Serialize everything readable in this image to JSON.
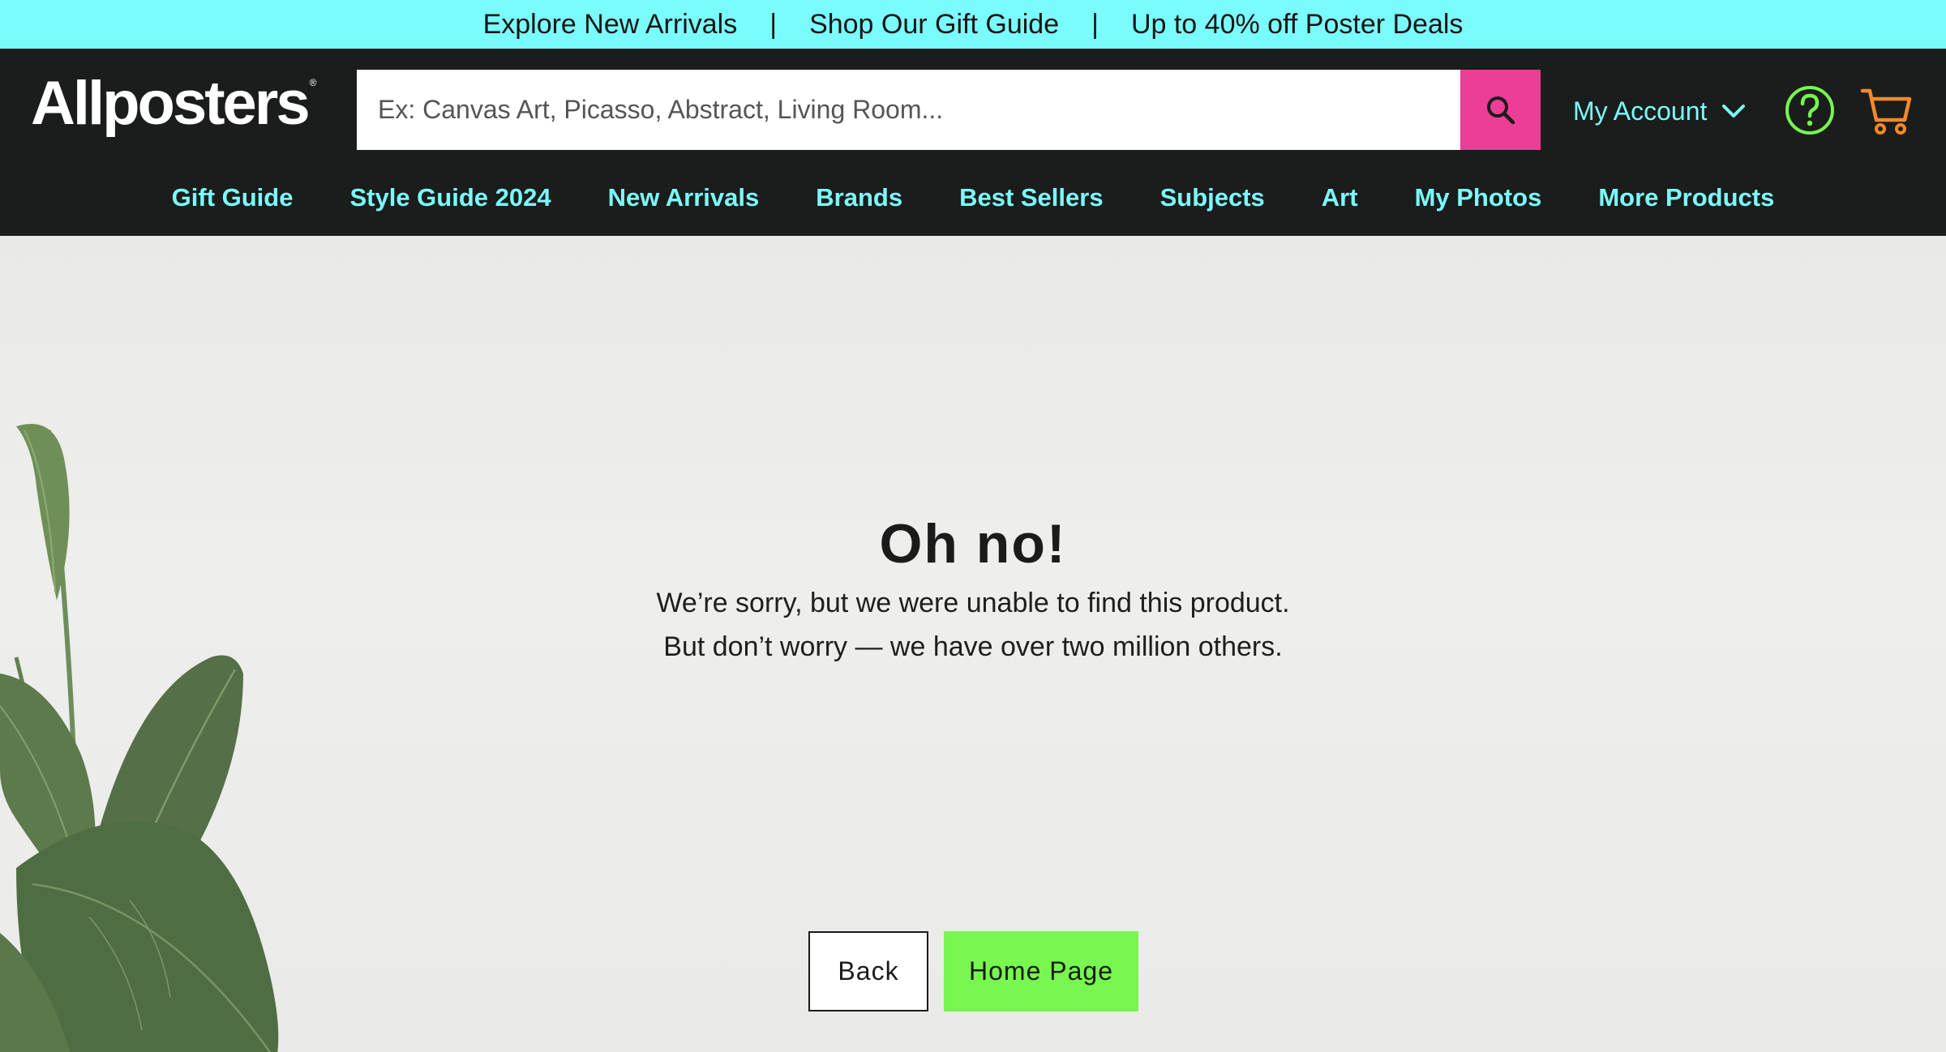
{
  "promo": {
    "items": [
      "Explore New Arrivals",
      "Shop Our Gift Guide",
      "Up to 40% off Poster Deals"
    ],
    "separator": "|"
  },
  "header": {
    "logo": "Allposters",
    "logo_mark": "®",
    "search_placeholder": "Ex: Canvas Art, Picasso, Abstract, Living Room...",
    "account_label": "My Account",
    "icons": {
      "search": "search-icon",
      "account_toggle": "chevron-down-icon",
      "help": "help-icon",
      "cart": "cart-icon"
    },
    "colors": {
      "search_button": "#ec3d97",
      "help_icon": "#77f74f",
      "cart_icon": "#f28a2b",
      "accent": "#7bfcfc"
    }
  },
  "nav": {
    "items": [
      "Gift Guide",
      "Style Guide 2024",
      "New Arrivals",
      "Brands",
      "Best Sellers",
      "Subjects",
      "Art",
      "My Photos",
      "More Products"
    ]
  },
  "error": {
    "title": "Oh no!",
    "line1": "We’re sorry, but we were unable to find this product.",
    "line2": "But don’t worry — we have over two million others.",
    "back_label": "Back",
    "home_label": "Home Page"
  }
}
